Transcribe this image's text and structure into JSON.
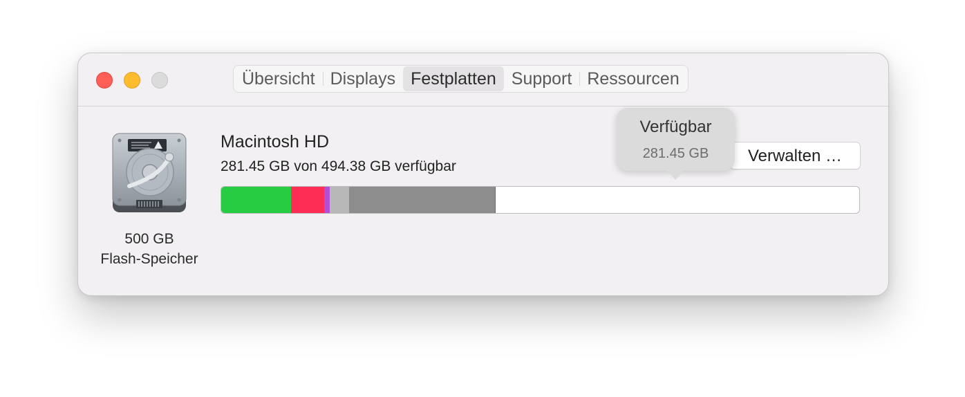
{
  "tabs": [
    {
      "label": "Übersicht",
      "active": false
    },
    {
      "label": "Displays",
      "active": false
    },
    {
      "label": "Festplatten",
      "active": true
    },
    {
      "label": "Support",
      "active": false
    },
    {
      "label": "Ressourcen",
      "active": false
    }
  ],
  "disk": {
    "icon": "hard-drive-icon",
    "capacity": "500 GB",
    "type": "Flash-Speicher"
  },
  "volume": {
    "name": "Macintosh HD",
    "info": "281.45 GB von 494.38 GB verfügbar",
    "manage_label": "Verwalten …"
  },
  "tooltip": {
    "title": "Verfügbar",
    "value": "281.45 GB"
  },
  "storage": {
    "free_gb": 281.45,
    "total_gb": 494.38,
    "colors": {
      "apps": "#27cc43",
      "documents": "#fd2d55",
      "photos": "#b24fd5",
      "other": "#b9b8b9",
      "system": "#8e8d8e",
      "free": "#ffffff"
    }
  },
  "window_controls": {
    "close_color": "#fd5f57",
    "minimize_color": "#febc2e",
    "zoom_color": "#dcdbdc"
  }
}
